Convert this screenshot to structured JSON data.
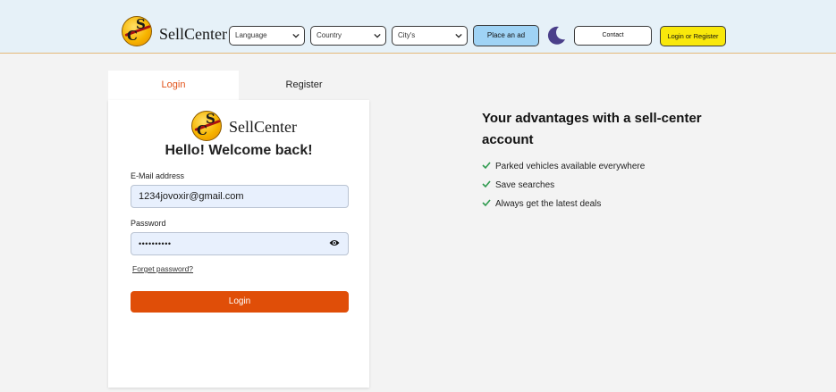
{
  "header": {
    "brand": "SellCenter",
    "logo_letters": [
      "S",
      "C"
    ],
    "language_select": "Language",
    "country_select": "Country",
    "city_select": "City's",
    "place_ad": "Place an ad",
    "contact": "Contact",
    "login_register": "Login or Register"
  },
  "tabs": [
    {
      "label": "Login",
      "active": true
    },
    {
      "label": "Register",
      "active": false
    }
  ],
  "form": {
    "brand": "SellCenter",
    "welcome": "Hello! Welcome back!",
    "email_label": "E-Mail address",
    "email_value": "1234jovoxir@gmail.com",
    "password_label": "Password",
    "password_value": "••••••••••",
    "forgot": "Forget password?",
    "submit": "Login"
  },
  "advantages": {
    "title": "Your advantages with a sell-center account",
    "items": [
      "Parked vehicles available everywhere",
      "Save searches",
      "Always get the latest deals"
    ]
  },
  "colors": {
    "accent": "#e04e08",
    "header_bg": "#e6f1f8",
    "check": "#2e9a4e",
    "login_button": "#f9e80b",
    "place_ad_button": "#9fd3f5"
  },
  "icons": [
    "chevron-down-icon",
    "moon-icon",
    "eye-icon",
    "check-icon"
  ]
}
